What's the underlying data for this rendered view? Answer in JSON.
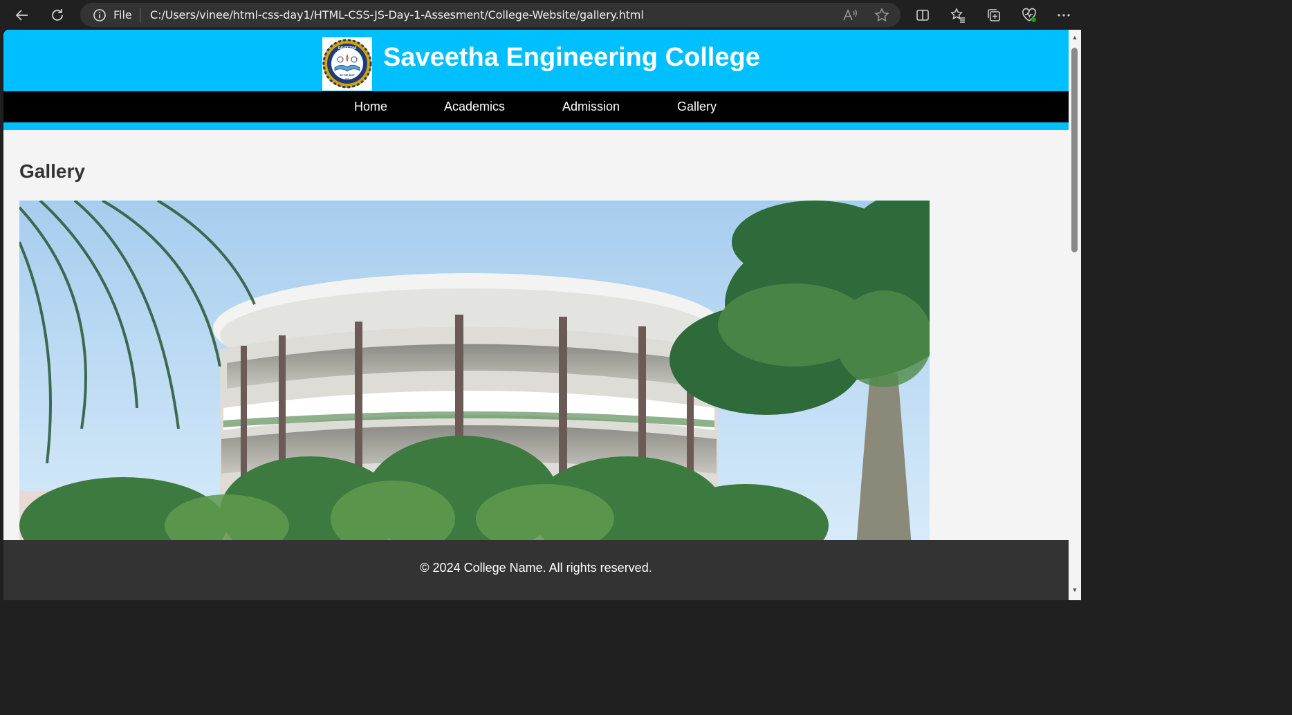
{
  "browser": {
    "address_scheme": "File",
    "url": "C:/Users/vinee/html-css-day1/HTML-CSS-JS-Day-1-Assesment/College-Website/gallery.html",
    "icons": [
      "back-icon",
      "refresh-icon",
      "info-icon",
      "read-aloud-icon",
      "favorite-star-icon",
      "split-screen-icon",
      "favorites-icon",
      "collections-icon",
      "browser-essentials-icon",
      "more-icon"
    ]
  },
  "site": {
    "title": "Saveetha Engineering College",
    "logo": {
      "top_text": "SAVEETHA",
      "sub_text": "ENGINEERING COLLEGE",
      "motto": "BE THE BEST",
      "year": "2001"
    },
    "nav": [
      "Home",
      "Academics",
      "Admission",
      "Gallery"
    ]
  },
  "page": {
    "heading": "Gallery"
  },
  "footer": {
    "text": "© 2024 College Name. All rights reserved."
  },
  "colors": {
    "header_bg": "#00bfff",
    "nav_bg": "#000000",
    "footer_bg": "#333333",
    "page_bg": "#f4f4f4"
  }
}
